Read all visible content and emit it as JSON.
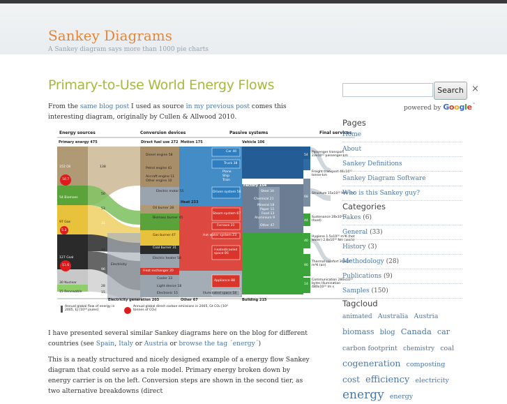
{
  "site": {
    "title": "Sankey Diagrams",
    "tagline": "A Sankey diagram says more than 1000 pie charts"
  },
  "post": {
    "title": "Primary-to-Use World Energy Flows",
    "intro": {
      "t1": "From the ",
      "link1": "same blog post",
      "t2": " I used as source ",
      "link2": "in my previous post",
      "t3": " comes this interesting diagram, originally by Cullen & Allwood 2010."
    },
    "para2": {
      "t1": "I have presented several similar Sankey diagrams here on the blog for different countries (see ",
      "link1": "Spain",
      "t2": ", ",
      "link2": "Italy",
      "t3": " or ",
      "link3": "Austria",
      "t4": " or ",
      "link4": "browse the tag ´energy´",
      "t5": ")"
    },
    "para3": "This is a neatly structured and nicely designed example of a energy flow Sankey diagram that could serve as a role model. Primary energy broken down by energy carrier is on the left. Conversion steps are shown in the second tier, as two alternative breakdowns (direct"
  },
  "figure": {
    "headers": [
      "Energy sources",
      "Conversion devices",
      "Passive systems",
      "Final services"
    ],
    "subheads": {
      "primary": "Primary energy 475",
      "direct": "Direct fuel use 272",
      "motion": "Motion 175",
      "vehicle": "Vehicle 106",
      "factory": "Factory 154",
      "heat": "Heat 233",
      "building": "Building 215",
      "other": "Other 67",
      "electricity_gen": "Electricity generation 203",
      "electricity": "Electricity"
    },
    "sources": [
      "152 Oil",
      "54 Biomass",
      "97 Gas",
      "127 Coal",
      "30 Nuclear",
      "15 Renewable"
    ],
    "source_values": [
      "138",
      "50",
      "53",
      "31",
      "44",
      "96",
      "28",
      "15"
    ],
    "emissions": [
      "10.7",
      "5.3",
      "11.6"
    ],
    "devices": [
      "Diesel engine 58",
      "Petrol engine 41",
      "Aircraft engine 11",
      "Other engine 10",
      "Electric motor 55",
      "Oil burner 28",
      "Biomass burner 45",
      "Gas burner 47",
      "Coal burner 31",
      "Electric heater 58",
      "Heat exchanger 20",
      "Cooler 33",
      "Light device 18",
      "Electronic 15"
    ],
    "passive": [
      "Car 40",
      "Truck 38",
      "Plane",
      "Ship",
      "Train",
      "Driven system 56",
      "Steam system 67",
      "Furnace 31",
      "Hot water system 23",
      "Heated/cooled space 86",
      "Appliance 88",
      "Illuminated space 18"
    ],
    "factory_items": [
      "Steel 34",
      "Chemical 21",
      "Mineral 18",
      "Paper 11",
      "Food 13",
      "Aluminium 9",
      "Other 47"
    ],
    "services": [
      "Passenger transport 23x10¹² passenger-km",
      "Freight transport 46x10¹² tonne-km",
      "Structure 15x10¹² MPa¹²m³",
      "Sustenance 28x10¹⁸ J (food)",
      "Hygiene 1.5x10¹⁰ m³K (hot water) 2.8x10¹⁰ Nm (work)",
      "Thermal comfort 30x10¹⁵ m³K (air)",
      "Communication 280x10¹⁸ bytes Illumination 480x10¹⁵ lm s"
    ],
    "service_values": [
      "54",
      "52",
      "68",
      "44",
      "40",
      "90",
      "14"
    ],
    "legend": {
      "flow": "Annual global flow of energy in 2005, EJ [10¹⁸ joules]",
      "emission": "Annual global direct carbon emissions in 2005, Gt CO₂ [10⁹ tonnes of CO₂]"
    },
    "colors": {
      "oil": "#b09a76",
      "biomass": "#5aa33a",
      "gas": "#e8c23a",
      "coal": "#2a2a2a",
      "nuclear": "#c8c8c8",
      "electricity": "#909aa4",
      "motion_blue": "#2f7fc0",
      "heat_red": "#d9352b",
      "factory_blue": "#245c96",
      "building_green": "#3aa43a",
      "emission_red": "#e01b1b"
    }
  },
  "sidebar": {
    "search_button": "Search",
    "search_close": "×",
    "powered_by": "powered by",
    "google": [
      "G",
      "o",
      "o",
      "g",
      "l",
      "e"
    ],
    "google_tm": "™",
    "pages_title": "Pages",
    "pages": [
      "Home",
      "About",
      "Sankey Definitions",
      "Sankey Diagram Software",
      "Who is this Sankey guy?"
    ],
    "categories_title": "Categories",
    "categories": [
      {
        "label": "Fakes",
        "count": "(6)"
      },
      {
        "label": "General",
        "count": "(33)"
      },
      {
        "label": "History",
        "count": "(3)"
      },
      {
        "label": "Methodology",
        "count": "(28)"
      },
      {
        "label": "Publications",
        "count": "(9)"
      },
      {
        "label": "Samples",
        "count": "(150)"
      }
    ],
    "tagcloud_title": "Tagcloud",
    "tags": [
      "animated",
      "Australia",
      "Austria",
      "biomass",
      "blog",
      "Canada",
      "car",
      "carbon footprint",
      "chemistry",
      "coal",
      "cogeneration",
      "composting",
      "cost",
      "efficiency",
      "electricity",
      "energy",
      "energy"
    ]
  }
}
